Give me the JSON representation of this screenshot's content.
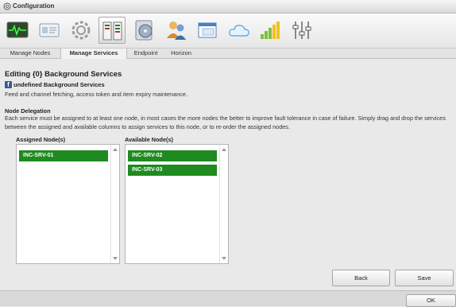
{
  "window": {
    "title": "Configuration"
  },
  "toolbar": {
    "icons": [
      "monitor-icon",
      "id-card-icon",
      "gear-icon",
      "services-list-icon",
      "disk-icon",
      "users-icon",
      "window-icon",
      "cloud-icon",
      "bar-chart-icon",
      "sliders-icon"
    ],
    "selected": "services-list-icon"
  },
  "tabs": [
    {
      "label": "Manage Nodes",
      "active": false
    },
    {
      "label": "Manage Services",
      "active": true
    },
    {
      "label": "Endpoint",
      "active": false
    },
    {
      "label": "Horizon",
      "active": false
    }
  ],
  "editing": {
    "heading": "Editing {0} Background Services",
    "service_name": "undefined Background Services",
    "service_icon": "facebook-icon",
    "service_description": "Feed and channel fetching, access token and item expiry maintenance."
  },
  "node_delegation": {
    "title": "Node Delegation",
    "description": "Each service must be assigned to at least one node, in most cases the more nodes the better to improve fault tolerance in case of failure. Simply drag and drop the services between the assigned and available columns to assign services to this node, or to re-order the assigned nodes."
  },
  "assigned": {
    "label": "Assigned Node(s)",
    "nodes": [
      "INC-SRV-01"
    ]
  },
  "available": {
    "label": "Available Node(s)",
    "nodes": [
      "INC-SRV-02",
      "INC-SRV-03"
    ]
  },
  "buttons": {
    "back": "Back",
    "save": "Save",
    "ok": "OK"
  },
  "colors": {
    "node_green": "#1f8a1f",
    "facebook_blue": "#3b5998"
  }
}
